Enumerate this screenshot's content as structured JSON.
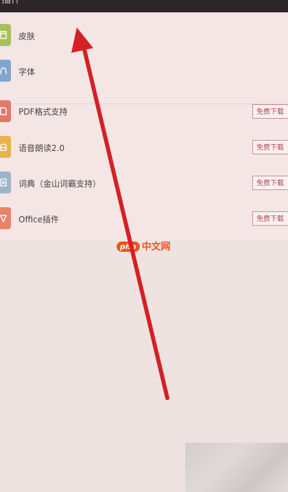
{
  "header": {
    "title": "插件"
  },
  "top_items": [
    {
      "label": "皮肤",
      "icon": "skin-icon",
      "color": "#a9c05a"
    },
    {
      "label": "字体",
      "icon": "font-icon",
      "color": "#7fa6cf"
    }
  ],
  "plugins": [
    {
      "label": "PDF格式支持",
      "icon": "pdf-icon",
      "color": "#e07b6a",
      "button": "免费下载"
    },
    {
      "label": "语音朗读2.0",
      "icon": "speech-icon",
      "color": "#e9b24e",
      "button": "免费下载"
    },
    {
      "label": "词典（金山词霸支持）",
      "icon": "dictionary-icon",
      "color": "#9bb6c9",
      "button": "免费下载"
    },
    {
      "label": "Office插件",
      "icon": "office-icon",
      "color": "#e8826a",
      "button": "免费下载"
    }
  ],
  "watermark": {
    "logo": "php",
    "text": "中文网"
  },
  "colors": {
    "arrow": "#d42126",
    "accent": "#b0485a",
    "header": "#2d2628"
  }
}
